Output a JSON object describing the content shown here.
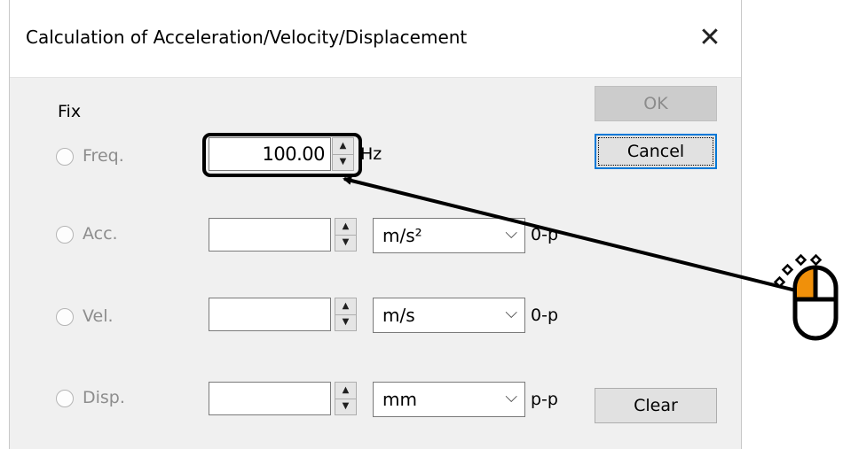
{
  "window": {
    "title": "Calculation of Acceleration/Velocity/Displacement"
  },
  "fix_label": "Fix",
  "rows": [
    {
      "radio_label": "Freq.",
      "value": "100.00",
      "unit": "Hz"
    },
    {
      "radio_label": "Acc.",
      "value": "",
      "unit": "m/s²",
      "mode": "0-p"
    },
    {
      "radio_label": "Vel.",
      "value": "",
      "unit": "m/s",
      "mode": "0-p"
    },
    {
      "radio_label": "Disp.",
      "value": "",
      "unit": "mm",
      "mode": "p-p"
    }
  ],
  "buttons": {
    "ok": "OK",
    "cancel": "Cancel",
    "clear": "Clear"
  },
  "icons": {
    "close": "close-icon",
    "spin_up": "spin-up-icon",
    "spin_down": "spin-down-icon",
    "dropdown": "chevron-down-icon",
    "mouse": "mouse-left-click-icon"
  },
  "colors": {
    "dialog_bg": "#f0f0f0",
    "focus_blue": "#0078d7",
    "mouse_accent": "#f0900a"
  }
}
